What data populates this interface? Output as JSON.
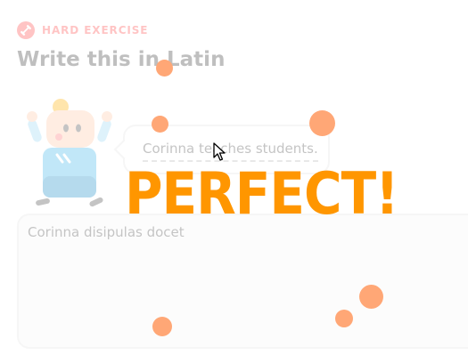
{
  "header": {
    "badge_label": "HARD EXERCISE",
    "badge_icon": "dumbbell-icon",
    "badge_color": "#ff4b4b",
    "title": "Write this in Latin"
  },
  "prompt": {
    "sentence": "Corinna teaches students."
  },
  "answer": {
    "value": "Corinna disipulas docet"
  },
  "feedback": {
    "text": "PERFECT!",
    "color": "#ff9600"
  },
  "confetti_color": "#ffa776"
}
